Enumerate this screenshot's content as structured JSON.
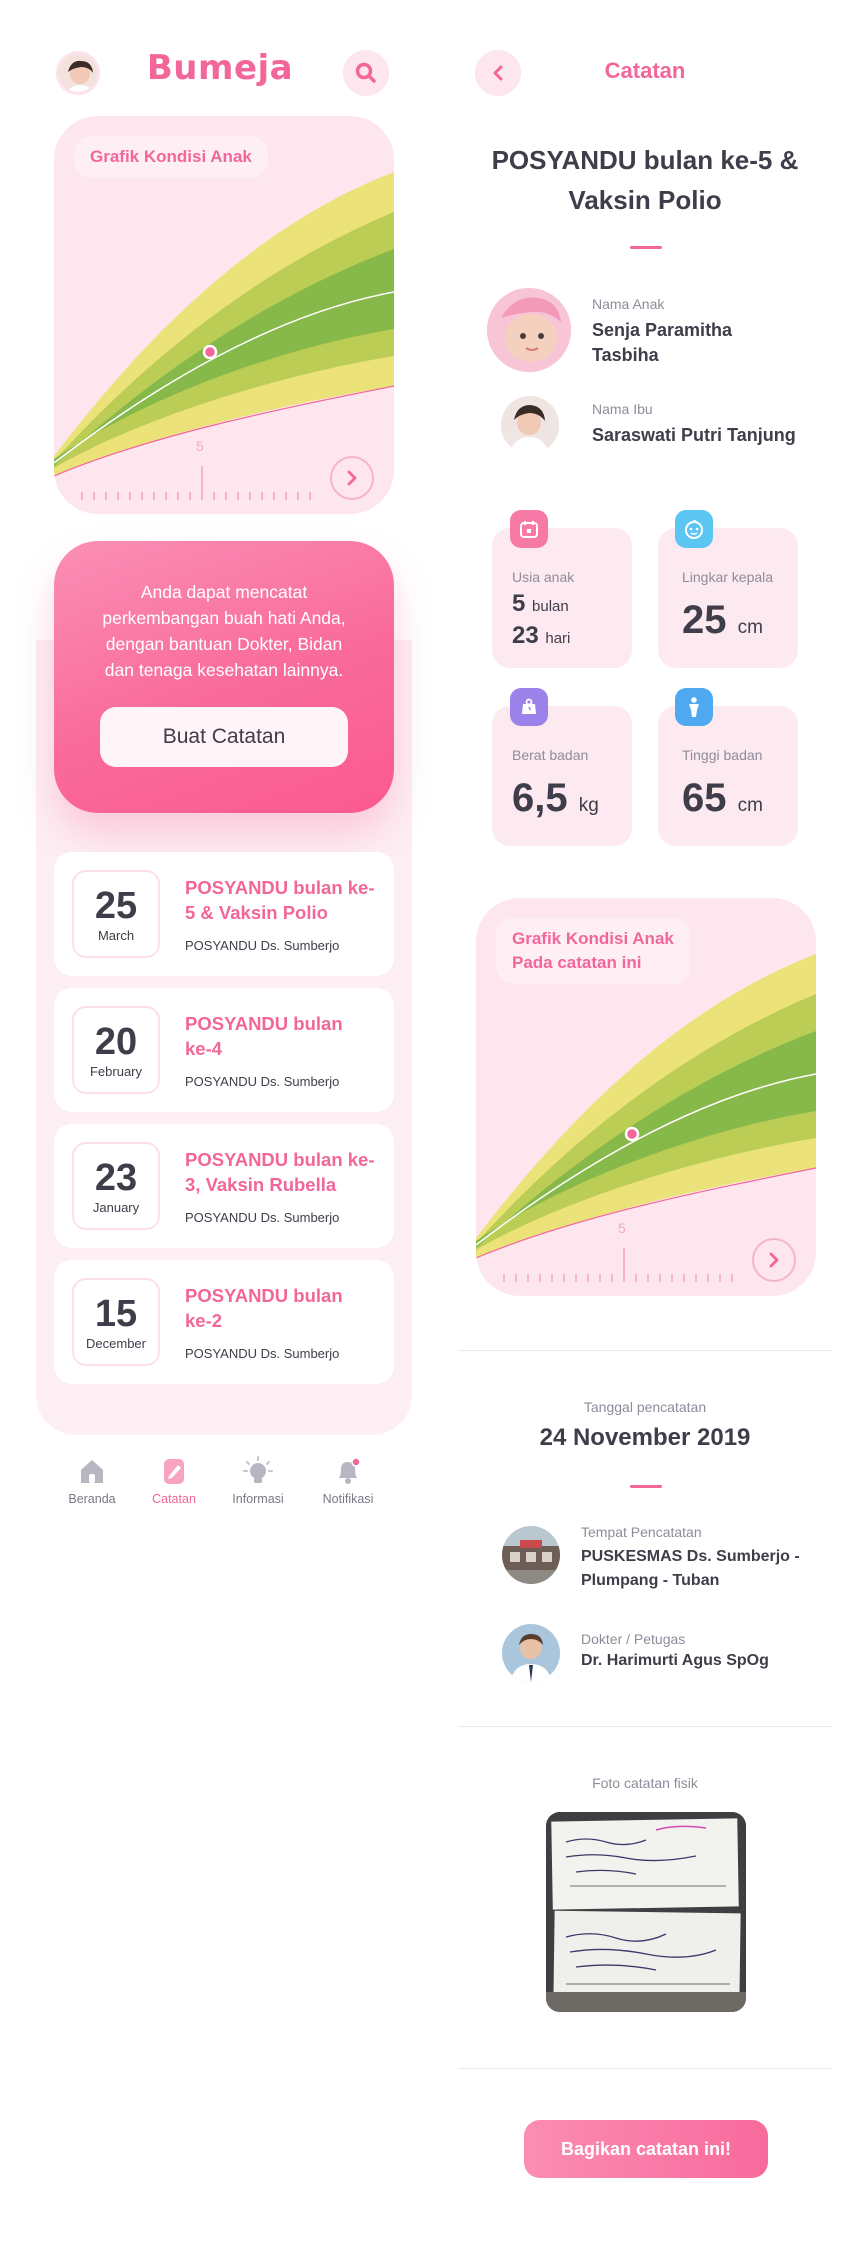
{
  "home": {
    "brand": "Bumeja",
    "chart_title": "Grafik Kondisi Anak",
    "chart_tick": "5",
    "cta": {
      "text": "Anda dapat mencatat perkembangan buah hati Anda, dengan bantuan Dokter, Bidan dan tenaga kesehatan lainnya.",
      "button": "Buat Catatan"
    },
    "records": [
      {
        "day": "25",
        "month": "March",
        "title": "POSYANDU bulan ke-5 & Vaksin Polio",
        "place": "POSYANDU Ds. Sumberjo"
      },
      {
        "day": "20",
        "month": "February",
        "title": "POSYANDU bulan ke-4",
        "place": "POSYANDU Ds. Sumberjo"
      },
      {
        "day": "23",
        "month": "January",
        "title": "POSYANDU bulan ke-3, Vaksin Rubella",
        "place": "POSYANDU Ds. Sumberjo"
      },
      {
        "day": "15",
        "month": "December",
        "title": "POSYANDU bulan ke-2",
        "place": "POSYANDU Ds. Sumberjo"
      }
    ],
    "nav": [
      {
        "label": "Beranda",
        "icon": "home-icon"
      },
      {
        "label": "Catatan",
        "icon": "note-icon"
      },
      {
        "label": "Informasi",
        "icon": "bulb-icon"
      },
      {
        "label": "Notifikasi",
        "icon": "bell-icon"
      }
    ]
  },
  "detail": {
    "page_title": "Catatan",
    "title": "POSYANDU bulan ke-5 & Vaksin Polio",
    "child_label": "Nama Anak",
    "child_name": "Senja Paramitha Tasbiha",
    "mother_label": "Nama Ibu",
    "mother_name": "Saraswati Putri Tanjung",
    "stats": {
      "age_label": "Usia anak",
      "age_months": "5",
      "age_months_unit": "bulan",
      "age_days": "23",
      "age_days_unit": "hari",
      "head_label": "Lingkar kepala",
      "head_value": "25",
      "head_unit": "cm",
      "weight_label": "Berat badan",
      "weight_value": "6,5",
      "weight_unit": "kg",
      "height_label": "Tinggi badan",
      "height_value": "65",
      "height_unit": "cm"
    },
    "chart_title_1": "Grafik Kondisi Anak",
    "chart_title_2": "Pada catatan ini",
    "chart_tick": "5",
    "date_label": "Tanggal pencatatan",
    "date_value": "24 November 2019",
    "place_label": "Tempat Pencatatan",
    "place_value": "PUSKESMAS Ds. Sumberjo - Plumpang - Tuban",
    "doctor_label": "Dokter / Petugas",
    "doctor_value": "Dr. Harimurti Agus SpOg",
    "photo_label": "Foto catatan fisik",
    "share_button": "Bagikan catatan ini!"
  },
  "colors": {
    "accent": "#f2669a",
    "band_yellow": "#ece27a",
    "band_lime": "#bccd55",
    "band_green": "#86b84a",
    "badge_pink": "#f679a6",
    "badge_blue": "#5cc6f2",
    "badge_purple": "#9b82ea",
    "badge_sky": "#4ea9f0"
  }
}
